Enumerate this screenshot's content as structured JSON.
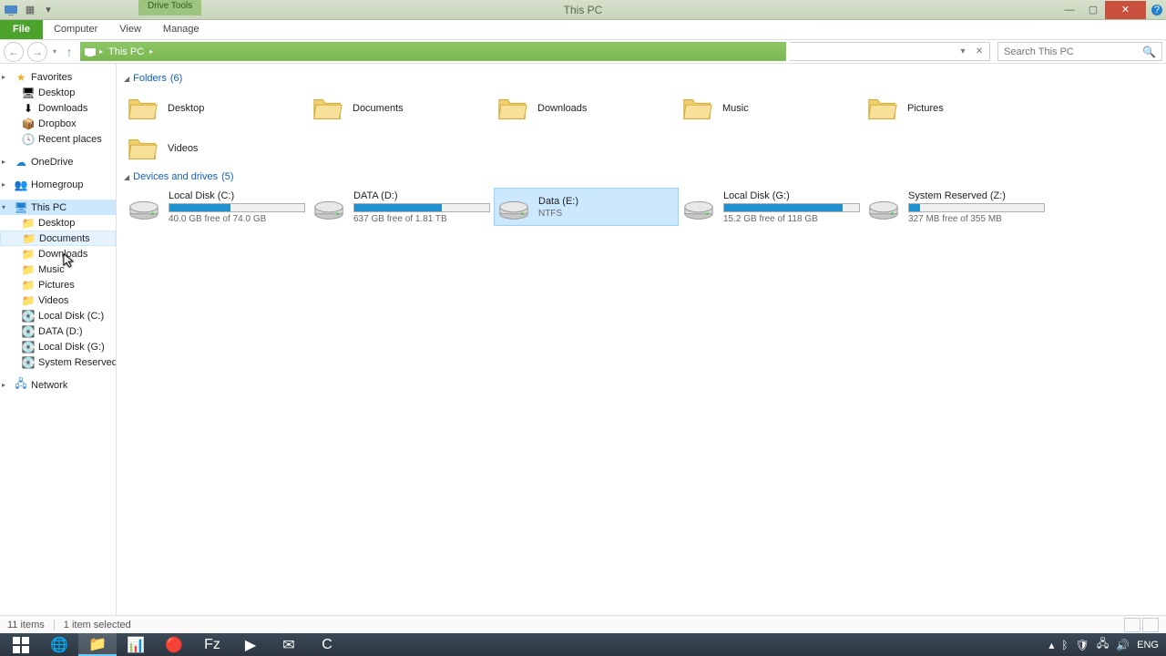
{
  "titlebar": {
    "context_tab": "Drive Tools",
    "title": "This PC"
  },
  "ribbon": {
    "file": "File",
    "computer": "Computer",
    "view": "View",
    "manage": "Manage"
  },
  "addressbar": {
    "segment": "This PC"
  },
  "search": {
    "placeholder": "Search This PC"
  },
  "sidebar": {
    "favorites": {
      "label": "Favorites",
      "items": [
        "Desktop",
        "Downloads",
        "Dropbox",
        "Recent places"
      ]
    },
    "onedrive": "OneDrive",
    "homegroup": "Homegroup",
    "thispc": {
      "label": "This PC",
      "items": [
        "Desktop",
        "Documents",
        "Downloads",
        "Music",
        "Pictures",
        "Videos",
        "Local Disk (C:)",
        "DATA (D:)",
        "Local Disk (G:)",
        "System Reserved (Z:)"
      ]
    },
    "network": "Network"
  },
  "sections": {
    "folders": {
      "label": "Folders",
      "count": "(6)"
    },
    "drives": {
      "label": "Devices and drives",
      "count": "(5)"
    }
  },
  "folders": [
    {
      "name": "Desktop"
    },
    {
      "name": "Documents"
    },
    {
      "name": "Downloads"
    },
    {
      "name": "Music"
    },
    {
      "name": "Pictures"
    },
    {
      "name": "Videos"
    }
  ],
  "drives": [
    {
      "name": "Local Disk (C:)",
      "stats": "40.0 GB free of 74.0 GB",
      "fill": 45,
      "selected": false
    },
    {
      "name": "DATA (D:)",
      "stats": "637 GB free of 1.81 TB",
      "fill": 65,
      "selected": false
    },
    {
      "name": "Data (E:)",
      "stats": "NTFS",
      "fill": 0,
      "selected": true,
      "nobar": true
    },
    {
      "name": "Local Disk (G:)",
      "stats": "15.2 GB free of 118 GB",
      "fill": 88,
      "selected": false
    },
    {
      "name": "System Reserved (Z:)",
      "stats": "327 MB free of 355 MB",
      "fill": 8,
      "selected": false
    }
  ],
  "status": {
    "items": "11 items",
    "selected": "1 item selected"
  },
  "tray": {
    "lang": "ENG",
    "time": "",
    "date": ""
  }
}
